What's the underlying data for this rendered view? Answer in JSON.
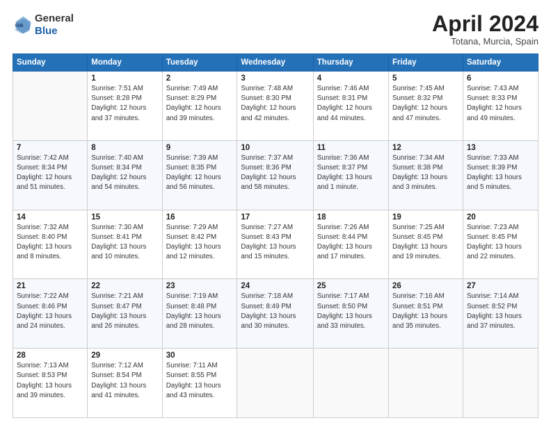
{
  "header": {
    "logo": {
      "general": "General",
      "blue": "Blue"
    },
    "title": "April 2024",
    "location": "Totana, Murcia, Spain"
  },
  "calendar": {
    "days": [
      "Sunday",
      "Monday",
      "Tuesday",
      "Wednesday",
      "Thursday",
      "Friday",
      "Saturday"
    ],
    "weeks": [
      [
        {
          "day": "",
          "info": ""
        },
        {
          "day": "1",
          "info": "Sunrise: 7:51 AM\nSunset: 8:28 PM\nDaylight: 12 hours\nand 37 minutes."
        },
        {
          "day": "2",
          "info": "Sunrise: 7:49 AM\nSunset: 8:29 PM\nDaylight: 12 hours\nand 39 minutes."
        },
        {
          "day": "3",
          "info": "Sunrise: 7:48 AM\nSunset: 8:30 PM\nDaylight: 12 hours\nand 42 minutes."
        },
        {
          "day": "4",
          "info": "Sunrise: 7:46 AM\nSunset: 8:31 PM\nDaylight: 12 hours\nand 44 minutes."
        },
        {
          "day": "5",
          "info": "Sunrise: 7:45 AM\nSunset: 8:32 PM\nDaylight: 12 hours\nand 47 minutes."
        },
        {
          "day": "6",
          "info": "Sunrise: 7:43 AM\nSunset: 8:33 PM\nDaylight: 12 hours\nand 49 minutes."
        }
      ],
      [
        {
          "day": "7",
          "info": "Sunrise: 7:42 AM\nSunset: 8:34 PM\nDaylight: 12 hours\nand 51 minutes."
        },
        {
          "day": "8",
          "info": "Sunrise: 7:40 AM\nSunset: 8:34 PM\nDaylight: 12 hours\nand 54 minutes."
        },
        {
          "day": "9",
          "info": "Sunrise: 7:39 AM\nSunset: 8:35 PM\nDaylight: 12 hours\nand 56 minutes."
        },
        {
          "day": "10",
          "info": "Sunrise: 7:37 AM\nSunset: 8:36 PM\nDaylight: 12 hours\nand 58 minutes."
        },
        {
          "day": "11",
          "info": "Sunrise: 7:36 AM\nSunset: 8:37 PM\nDaylight: 13 hours\nand 1 minute."
        },
        {
          "day": "12",
          "info": "Sunrise: 7:34 AM\nSunset: 8:38 PM\nDaylight: 13 hours\nand 3 minutes."
        },
        {
          "day": "13",
          "info": "Sunrise: 7:33 AM\nSunset: 8:39 PM\nDaylight: 13 hours\nand 5 minutes."
        }
      ],
      [
        {
          "day": "14",
          "info": "Sunrise: 7:32 AM\nSunset: 8:40 PM\nDaylight: 13 hours\nand 8 minutes."
        },
        {
          "day": "15",
          "info": "Sunrise: 7:30 AM\nSunset: 8:41 PM\nDaylight: 13 hours\nand 10 minutes."
        },
        {
          "day": "16",
          "info": "Sunrise: 7:29 AM\nSunset: 8:42 PM\nDaylight: 13 hours\nand 12 minutes."
        },
        {
          "day": "17",
          "info": "Sunrise: 7:27 AM\nSunset: 8:43 PM\nDaylight: 13 hours\nand 15 minutes."
        },
        {
          "day": "18",
          "info": "Sunrise: 7:26 AM\nSunset: 8:44 PM\nDaylight: 13 hours\nand 17 minutes."
        },
        {
          "day": "19",
          "info": "Sunrise: 7:25 AM\nSunset: 8:45 PM\nDaylight: 13 hours\nand 19 minutes."
        },
        {
          "day": "20",
          "info": "Sunrise: 7:23 AM\nSunset: 8:45 PM\nDaylight: 13 hours\nand 22 minutes."
        }
      ],
      [
        {
          "day": "21",
          "info": "Sunrise: 7:22 AM\nSunset: 8:46 PM\nDaylight: 13 hours\nand 24 minutes."
        },
        {
          "day": "22",
          "info": "Sunrise: 7:21 AM\nSunset: 8:47 PM\nDaylight: 13 hours\nand 26 minutes."
        },
        {
          "day": "23",
          "info": "Sunrise: 7:19 AM\nSunset: 8:48 PM\nDaylight: 13 hours\nand 28 minutes."
        },
        {
          "day": "24",
          "info": "Sunrise: 7:18 AM\nSunset: 8:49 PM\nDaylight: 13 hours\nand 30 minutes."
        },
        {
          "day": "25",
          "info": "Sunrise: 7:17 AM\nSunset: 8:50 PM\nDaylight: 13 hours\nand 33 minutes."
        },
        {
          "day": "26",
          "info": "Sunrise: 7:16 AM\nSunset: 8:51 PM\nDaylight: 13 hours\nand 35 minutes."
        },
        {
          "day": "27",
          "info": "Sunrise: 7:14 AM\nSunset: 8:52 PM\nDaylight: 13 hours\nand 37 minutes."
        }
      ],
      [
        {
          "day": "28",
          "info": "Sunrise: 7:13 AM\nSunset: 8:53 PM\nDaylight: 13 hours\nand 39 minutes."
        },
        {
          "day": "29",
          "info": "Sunrise: 7:12 AM\nSunset: 8:54 PM\nDaylight: 13 hours\nand 41 minutes."
        },
        {
          "day": "30",
          "info": "Sunrise: 7:11 AM\nSunset: 8:55 PM\nDaylight: 13 hours\nand 43 minutes."
        },
        {
          "day": "",
          "info": ""
        },
        {
          "day": "",
          "info": ""
        },
        {
          "day": "",
          "info": ""
        },
        {
          "day": "",
          "info": ""
        }
      ]
    ]
  }
}
